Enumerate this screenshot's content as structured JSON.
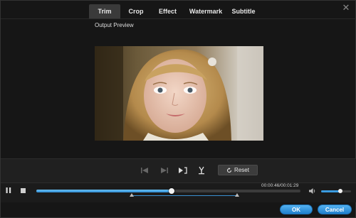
{
  "window": {
    "close_glyph": "✕"
  },
  "tabs": [
    {
      "label": "Trim",
      "active": true
    },
    {
      "label": "Crop",
      "active": false
    },
    {
      "label": "Effect",
      "active": false
    },
    {
      "label": "Watermark",
      "active": false
    },
    {
      "label": "Subtitle",
      "active": false
    }
  ],
  "preview": {
    "label": "Output Preview"
  },
  "edit_controls": {
    "prev_icon": "skip-to-start-icon",
    "next_icon": "skip-to-end-icon",
    "mark_icon": "mark-frame-icon",
    "split_icon": "split-icon",
    "reset_label": "Reset"
  },
  "player": {
    "time": "00:00:46/00:01:29",
    "progress": 0.513,
    "trim_start": 0.36,
    "trim_end": 0.76,
    "volume": 0.65,
    "play_state_icon": "pause-icon"
  },
  "footer": {
    "ok_label": "OK",
    "cancel_label": "Cancel"
  },
  "colors": {
    "accent": "#2f8fd6",
    "background": "#161616"
  }
}
